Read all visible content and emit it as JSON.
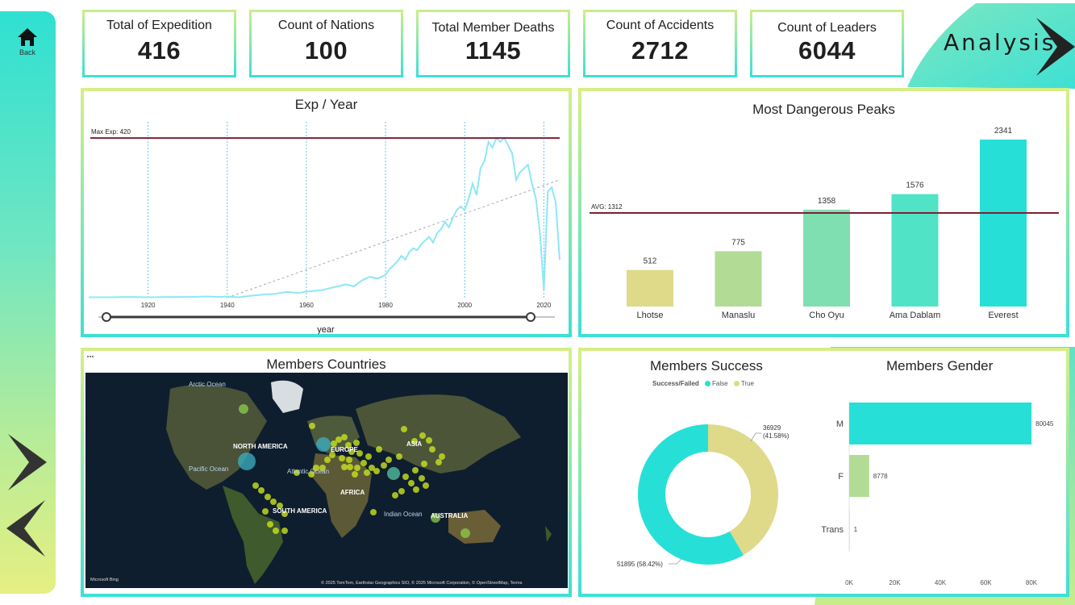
{
  "sidebar": {
    "home_label": "Back"
  },
  "header": {
    "title": "Analysis"
  },
  "kpis": [
    {
      "label": "Total of Expedition",
      "value": "416"
    },
    {
      "label": "Count of Nations",
      "value": "100"
    },
    {
      "label": "Total Member Deaths",
      "value": "1145"
    },
    {
      "label": "Count of Accidents",
      "value": "2712"
    },
    {
      "label": "Count of Leaders",
      "value": "6044"
    }
  ],
  "exp_year": {
    "title": "Exp / Year",
    "max_label": "Max Exp: 420",
    "slider_label": "year",
    "ticks": [
      "1920",
      "1940",
      "1960",
      "1980",
      "2000",
      "2020"
    ]
  },
  "peaks": {
    "title": "Most Dangerous Peaks",
    "avg_label": "AVG: 1312"
  },
  "map": {
    "title": "Members Countries",
    "labels": [
      "Arctic Ocean",
      "NORTH AMERICA",
      "EUROPE",
      "ASIA",
      "Pacific Ocean",
      "Atlantic Ocean",
      "AFRICA",
      "SOUTH AMERICA",
      "Indian Ocean",
      "AUSTRALIA"
    ],
    "attribution": "© 2025 TomTom, Earthstar Geographics SIO, © 2025 Microsoft Corporation, © OpenStreetMap, Terms",
    "bing": "Microsoft Bing"
  },
  "success": {
    "title": "Members Success",
    "legend_title": "Success/Failed",
    "legend_false": "False",
    "legend_true": "True",
    "label_true_1": "36929",
    "label_true_2": "(41.58%)",
    "label_false": "51895 (58.42%)"
  },
  "gender": {
    "title": "Members Gender"
  },
  "colors": {
    "teal": "#26e0d8",
    "khaki": "#dfd98a",
    "light_green": "#b2dc95",
    "mint": "#7fdfb0",
    "aqua": "#50e3c6",
    "line": "#8ce8f5",
    "ref_line": "#7a2233"
  },
  "chart_data": [
    {
      "type": "line",
      "title": "Exp / Year",
      "xlabel": "year",
      "x_ticks": [
        1920,
        1940,
        1960,
        1980,
        2000,
        2020
      ],
      "xlim": [
        1905,
        2024
      ],
      "ylim": [
        0,
        450
      ],
      "reference_line": {
        "label": "Max Exp: 420",
        "value": 420
      },
      "trend_line": {
        "from": [
          1940,
          0
        ],
        "to": [
          2024,
          310
        ]
      },
      "series": [
        {
          "x": [
            1905,
            1910,
            1915,
            1920,
            1925,
            1930,
            1935,
            1938,
            1940,
            1943,
            1946,
            1949,
            1952,
            1955,
            1958,
            1960,
            1962,
            1964,
            1966,
            1968,
            1970,
            1972,
            1974,
            1976,
            1978,
            1980,
            1981,
            1982,
            1983,
            1984,
            1985,
            1986,
            1987,
            1988,
            1989,
            1990,
            1991,
            1992,
            1993,
            1994,
            1995,
            1996,
            1997,
            1998,
            1999,
            2000,
            2001,
            2002,
            2003,
            2004,
            2005,
            2006,
            2007,
            2008,
            2009,
            2010,
            2011,
            2012,
            2013,
            2014,
            2015,
            2016,
            2017,
            2018,
            2019,
            2020,
            2021,
            2022,
            2023,
            2024
          ],
          "values": [
            1,
            1,
            2,
            1,
            2,
            2,
            3,
            2,
            3,
            1,
            5,
            8,
            10,
            15,
            12,
            16,
            18,
            20,
            25,
            30,
            35,
            30,
            45,
            55,
            50,
            60,
            75,
            85,
            95,
            110,
            100,
            120,
            130,
            125,
            140,
            150,
            160,
            145,
            170,
            180,
            200,
            185,
            210,
            230,
            240,
            230,
            260,
            300,
            270,
            340,
            360,
            410,
            395,
            420,
            410,
            420,
            400,
            380,
            310,
            330,
            340,
            350,
            300,
            260,
            170,
            20,
            280,
            290,
            250,
            100
          ]
        }
      ]
    },
    {
      "type": "bar",
      "title": "Most Dangerous Peaks",
      "categories": [
        "Lhotse",
        "Manaslu",
        "Cho Oyu",
        "Ama Dablam",
        "Everest"
      ],
      "values": [
        512,
        775,
        1358,
        1576,
        2341
      ],
      "reference_line": {
        "label": "AVG: 1312",
        "value": 1312
      },
      "ylim": [
        0,
        2500
      ]
    },
    {
      "type": "pie",
      "title": "Members Success",
      "legend": "Success/Failed",
      "labels": [
        "False",
        "True"
      ],
      "values": [
        51895,
        36929
      ],
      "percent": [
        58.42,
        41.58
      ]
    },
    {
      "type": "bar",
      "title": "Members Gender",
      "orientation": "horizontal",
      "categories": [
        "M",
        "F",
        "Trans"
      ],
      "values": [
        80045,
        8778,
        1
      ],
      "x_ticks": [
        "0K",
        "20K",
        "40K",
        "60K",
        "80K"
      ],
      "xlim": [
        0,
        80000
      ]
    }
  ]
}
